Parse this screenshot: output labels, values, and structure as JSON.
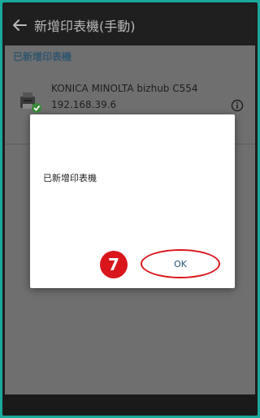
{
  "appbar": {
    "title": "新增印表機(手動)",
    "back_icon": "arrow-left-icon"
  },
  "section_header": "已新增印表機",
  "printer": {
    "name": "KONICA MINOLTA bizhub C554",
    "ip": "192.168.39.6",
    "icon": "printer-added-icon",
    "info_icon": "info-icon"
  },
  "dialog": {
    "message": "已新增印表機",
    "ok_label": "OK",
    "step_number": "7"
  },
  "colors": {
    "accent_red": "#d9161c",
    "link_blue": "#2b5876",
    "frame_teal": "#1aa89a"
  }
}
